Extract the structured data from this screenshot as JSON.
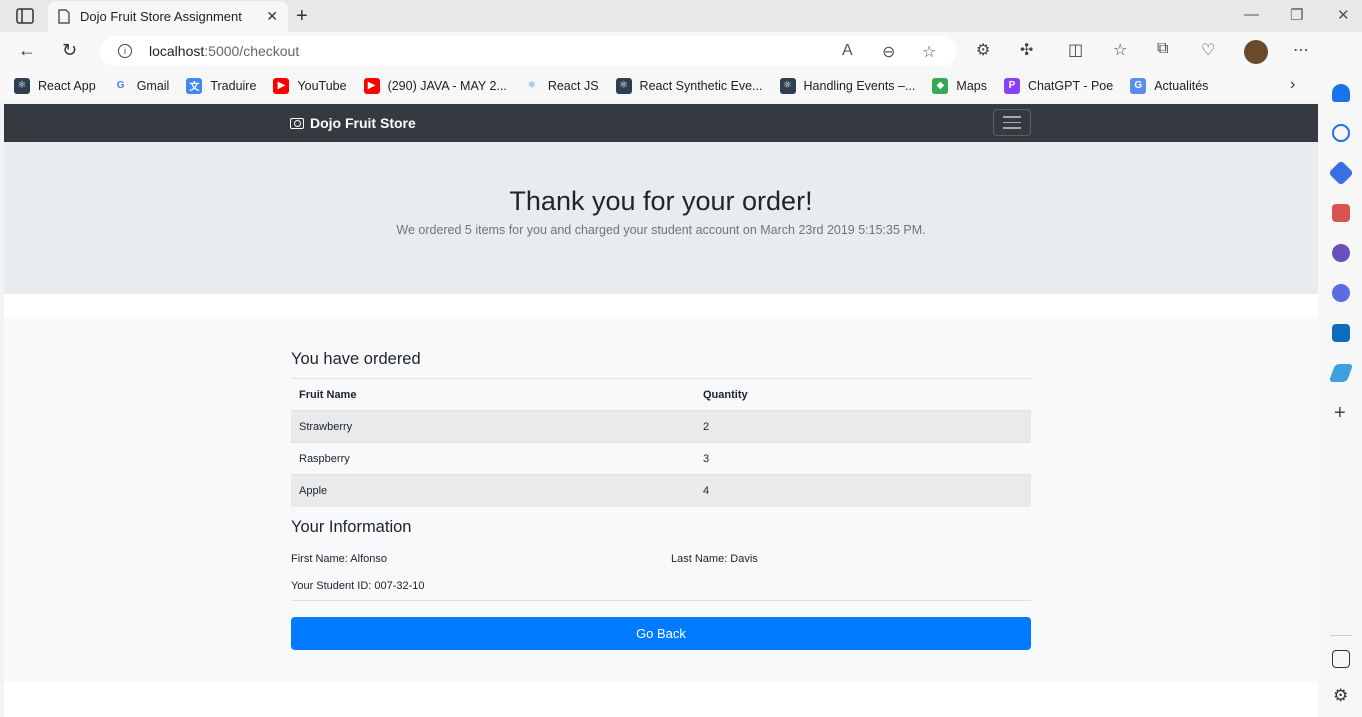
{
  "browser": {
    "tab_title": "Dojo Fruit Store Assignment",
    "url_host": "localhost",
    "url_path": ":5000/checkout"
  },
  "bookmarks": [
    {
      "label": "React App",
      "icon": "react-icon",
      "color": "#2c3e50"
    },
    {
      "label": "Gmail",
      "icon": "google-icon",
      "color": "#ffffff"
    },
    {
      "label": "Traduire",
      "icon": "translate-icon",
      "color": "#4285f4"
    },
    {
      "label": "YouTube",
      "icon": "youtube-icon",
      "color": "#ff0000"
    },
    {
      "label": "(290) JAVA - MAY 2...",
      "icon": "youtube-icon",
      "color": "#ff0000"
    },
    {
      "label": "React JS",
      "icon": "react-icon",
      "color": "#ffffff"
    },
    {
      "label": "React Synthetic Eve...",
      "icon": "react-icon",
      "color": "#2c3e50"
    },
    {
      "label": "Handling Events –...",
      "icon": "react-icon",
      "color": "#2c3e50"
    },
    {
      "label": "Maps",
      "icon": "maps-icon",
      "color": "#34a853"
    },
    {
      "label": "ChatGPT - Poe",
      "icon": "poe-icon",
      "color": "#8a3ffc"
    },
    {
      "label": "Actualités",
      "icon": "news-icon",
      "color": "#5b8def"
    }
  ],
  "navbar": {
    "brand": "Dojo Fruit Store"
  },
  "jumbotron": {
    "heading": "Thank you for your order!",
    "lead": "We ordered 5 items for you and charged your student account on March 23rd 2019 5:15:35 PM."
  },
  "order": {
    "title": "You have ordered",
    "headers": [
      "Fruit Name",
      "Quantity"
    ],
    "rows": [
      {
        "name": "Strawberry",
        "qty": "2"
      },
      {
        "name": "Raspberry",
        "qty": "3"
      },
      {
        "name": "Apple",
        "qty": "4"
      }
    ]
  },
  "info": {
    "title": "Your Information",
    "first_name": "First Name: Alfonso",
    "last_name": "Last Name: Davis",
    "student_id": "Your Student ID: 007-32-10"
  },
  "actions": {
    "go_back": "Go Back"
  },
  "colors": {
    "navbar": "#343a40",
    "jumbotron": "#e9ecef",
    "primary_button": "#007bff"
  }
}
